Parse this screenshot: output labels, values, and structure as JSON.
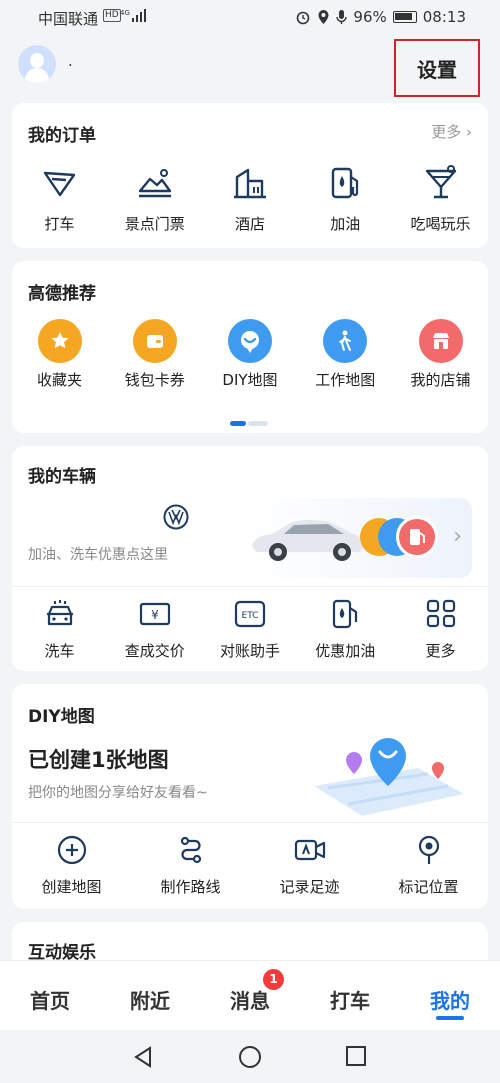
{
  "status": {
    "carrier": "中国联通",
    "hd": "HD",
    "signal": "⁴ᴳ",
    "battery": "96%",
    "time": "08:13"
  },
  "header": {
    "username": ".",
    "settings_label": "设置"
  },
  "orders": {
    "title": "我的订单",
    "more": "更多",
    "items": [
      {
        "label": "打车",
        "icon": "taxi-icon"
      },
      {
        "label": "景点门票",
        "icon": "scenic-ticket-icon"
      },
      {
        "label": "酒店",
        "icon": "hotel-icon"
      },
      {
        "label": "加油",
        "icon": "fuel-icon"
      },
      {
        "label": "吃喝玩乐",
        "icon": "cocktail-icon"
      }
    ]
  },
  "recommend": {
    "title": "高德推荐",
    "items": [
      {
        "label": "收藏夹",
        "icon": "star-icon",
        "color": "#f5a623"
      },
      {
        "label": "钱包卡券",
        "icon": "wallet-icon",
        "color": "#f5a623"
      },
      {
        "label": "DIY地图",
        "icon": "diy-map-icon",
        "color": "#3f9bf0"
      },
      {
        "label": "工作地图",
        "icon": "walker-icon",
        "color": "#3f9bf0"
      },
      {
        "label": "我的店铺",
        "icon": "shop-icon",
        "color": "#f26b6b"
      }
    ]
  },
  "vehicle": {
    "title": "我的车辆",
    "promo": "加油、洗车优惠点这里",
    "items": [
      {
        "label": "洗车",
        "icon": "car-wash-icon"
      },
      {
        "label": "查成交价",
        "icon": "price-tag-icon"
      },
      {
        "label": "对账助手",
        "icon": "etc-icon"
      },
      {
        "label": "优惠加油",
        "icon": "fuel-discount-icon"
      },
      {
        "label": "更多",
        "icon": "grid-icon"
      }
    ]
  },
  "diy": {
    "title": "DIY地图",
    "headline": "已创建1张地图",
    "subtitle": "把你的地图分享给好友看看~",
    "items": [
      {
        "label": "创建地图",
        "icon": "plus-circle-icon"
      },
      {
        "label": "制作路线",
        "icon": "route-icon"
      },
      {
        "label": "记录足迹",
        "icon": "video-camera-icon"
      },
      {
        "label": "标记位置",
        "icon": "location-pin-icon"
      }
    ]
  },
  "entertainment": {
    "title": "互动娱乐"
  },
  "tabs": [
    {
      "label": "首页"
    },
    {
      "label": "附近"
    },
    {
      "label": "消息",
      "badge": "1"
    },
    {
      "label": "打车"
    },
    {
      "label": "我的",
      "active": true
    }
  ],
  "colors": {
    "accent": "#1a73e8",
    "highlight_box": "#c62828",
    "badge": "#f23b3b"
  }
}
